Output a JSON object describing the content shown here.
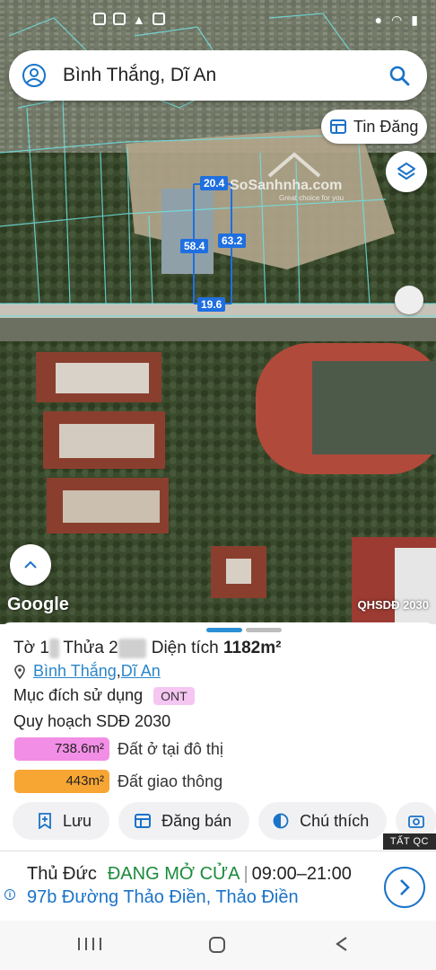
{
  "search": {
    "text": "Bình Thắng, Dĩ An"
  },
  "map": {
    "tin_dang_label": "Tin Đăng",
    "google_label": "Google",
    "layer_label": "QHSDĐ 2030",
    "watermark": "SoSanhnha.com",
    "watermark_tagline": "Great choice for you",
    "measures": [
      "20.4",
      "58.4",
      "63.2",
      "19.6"
    ],
    "measure_color": "#1f6fe0"
  },
  "sheet": {
    "title_prefix": "Tờ 1",
    "title_blur1": "6",
    "title_mid": " Thửa 2",
    "title_blur2": "000",
    "title_area_label": " Diện tích ",
    "title_area_value": "1182m²",
    "ward": "Bình Thắng",
    "comma": ", ",
    "city": "Dĩ An",
    "purpose_label": "Mục đích sử dụng",
    "purpose_code": "ONT",
    "plan_label": "Quy hoạch SDĐ 2030",
    "zones": [
      {
        "value": "738.6m²",
        "label": "Đất ở tại đô thị",
        "color": "#f28ee6"
      },
      {
        "value": "443m²",
        "label": "Đất giao thông",
        "color": "#f7a533"
      }
    ],
    "actions": [
      {
        "label": "Lưu",
        "icon": "bookmark-add-icon"
      },
      {
        "label": "Đăng bán",
        "icon": "listing-icon"
      },
      {
        "label": "Chú thích",
        "icon": "legend-icon"
      },
      {
        "label": "",
        "icon": "camera-add-icon"
      }
    ],
    "pager_colors": [
      "#2b8fd6",
      "#bdbdbd"
    ]
  },
  "ad": {
    "tag": "TẤT QC",
    "name": "Thủ Đức",
    "status": "ĐANG MỞ CỬA",
    "hours": "09:00–21:00",
    "address": "97b Đường Thảo Điền, Thảo Điền",
    "accent": "#1a73c8"
  }
}
